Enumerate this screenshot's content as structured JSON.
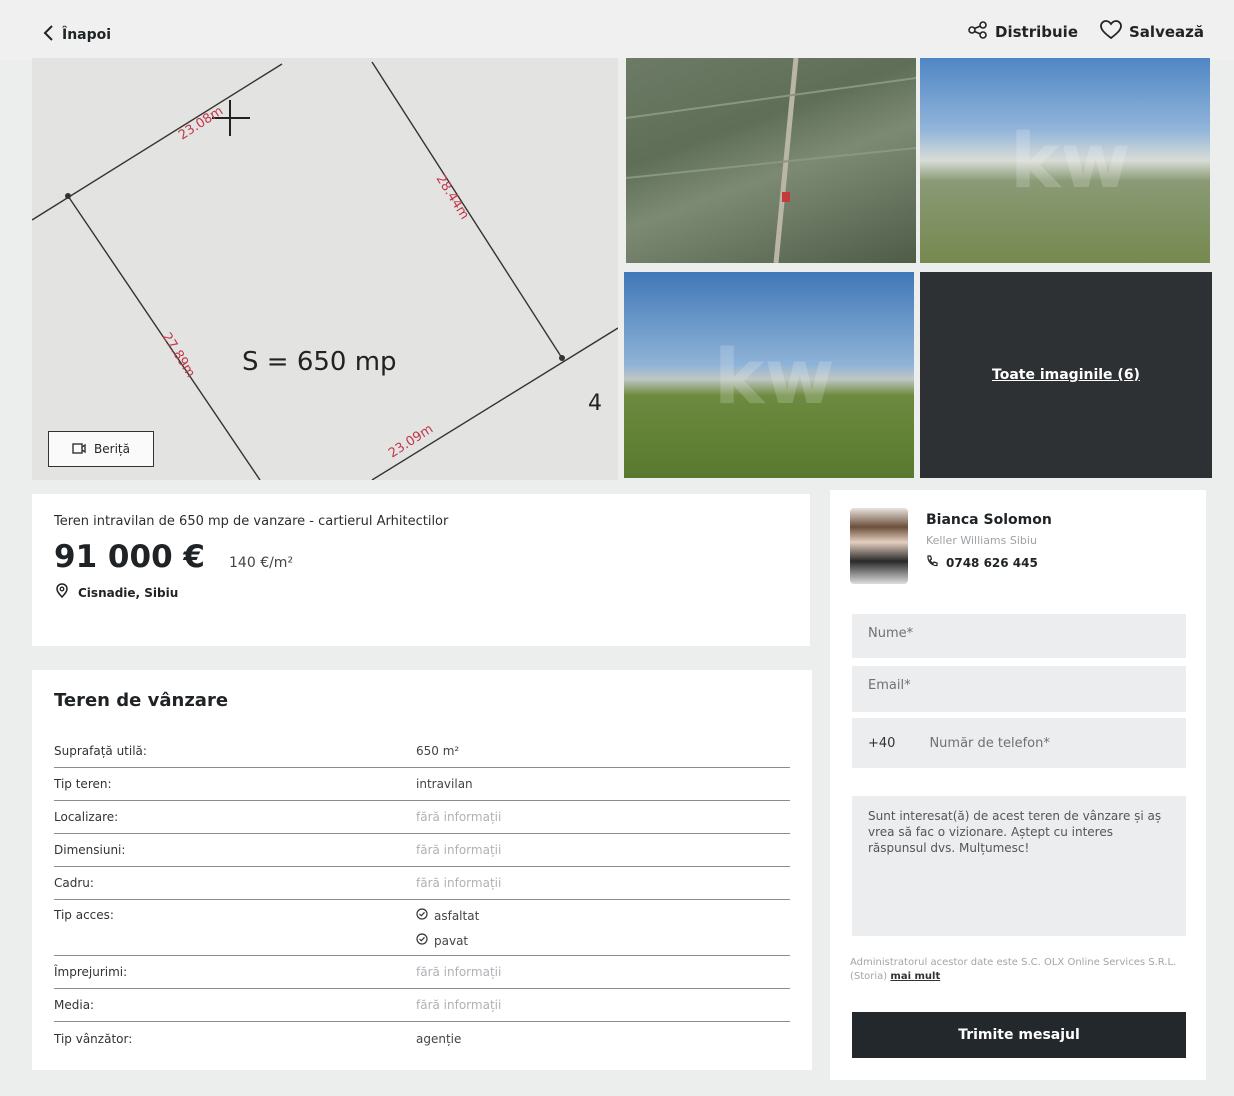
{
  "header": {
    "back_label": "Înapoi",
    "share_label": "Distribuie",
    "save_label": "Salvează"
  },
  "gallery": {
    "plan_area_text": "S = 650 mp",
    "plan_edges": [
      "23.08m",
      "28.44m",
      "27.89m",
      "23.09m"
    ],
    "plan_corner": "4",
    "street_view_label": "Beriță",
    "watermark": "kw",
    "all_images_label": "Toate imaginile (6)"
  },
  "listing": {
    "title": "Teren intravilan de 650 mp de vanzare - cartierul Arhitectilor",
    "price": "91 000 €",
    "price_per_sqm": "140 €/m²",
    "location": "Cisnadie, Sibiu"
  },
  "details": {
    "heading": "Teren de vânzare",
    "rows": [
      {
        "label": "Suprafață utilă:",
        "value": "650 m²",
        "muted": false
      },
      {
        "label": "Tip teren:",
        "value": "intravilan",
        "muted": false
      },
      {
        "label": "Localizare:",
        "value": "fără informații",
        "muted": true
      },
      {
        "label": "Dimensiuni:",
        "value": "fără informații",
        "muted": true
      },
      {
        "label": "Cadru:",
        "value": "fără informații",
        "muted": true
      },
      {
        "label": "Tip acces:",
        "value": "",
        "muted": false
      },
      {
        "label": "Împrejurimi:",
        "value": "fără informații",
        "muted": true
      },
      {
        "label": "Media:",
        "value": "fără informații",
        "muted": true
      },
      {
        "label": "Tip vânzător:",
        "value": "agenție",
        "muted": false
      }
    ],
    "access": [
      "asfaltat",
      "pavat"
    ]
  },
  "contact": {
    "agent_name": "Bianca Solomon",
    "agency": "Keller Williams Sibiu",
    "phone": "0748 626 445",
    "name_placeholder": "Nume*",
    "email_placeholder": "Email*",
    "country_code": "+40",
    "phone_placeholder": "Număr de telefon*",
    "message": "Sunt interesat(ă) de acest teren de vânzare și aș vrea să fac o vizionare. Aștept cu interes răspunsul dvs. Mulțumesc!",
    "legal_text": "Administratorul acestor date este S.C. OLX Online Services S.R.L. (Storia)",
    "legal_link": "mai mult",
    "submit_label": "Trimite mesajul"
  }
}
